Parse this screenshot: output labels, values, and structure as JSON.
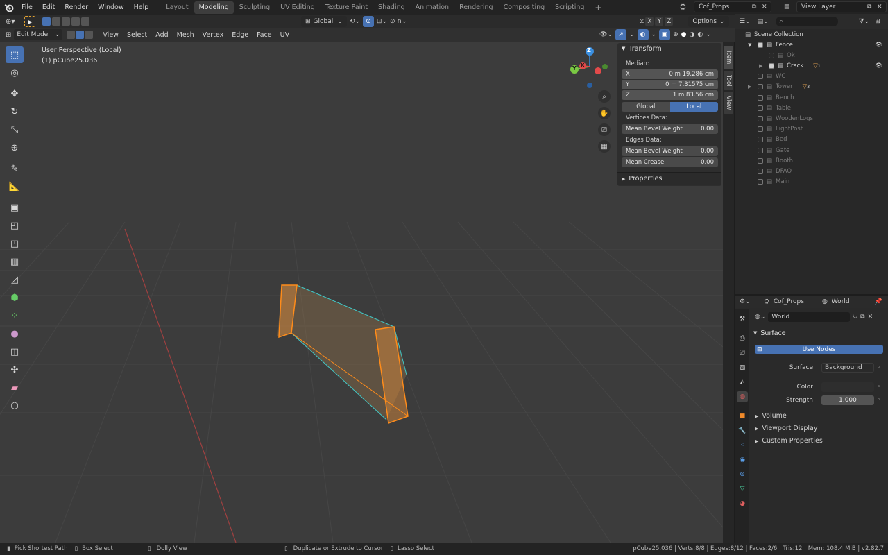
{
  "topbar": {
    "menus": [
      "File",
      "Edit",
      "Render",
      "Window",
      "Help"
    ],
    "workspaces": [
      "Layout",
      "Modeling",
      "Sculpting",
      "UV Editing",
      "Texture Paint",
      "Shading",
      "Animation",
      "Rendering",
      "Compositing",
      "Scripting"
    ],
    "active_workspace": "Modeling",
    "add_tab": "+",
    "scene": "Cof_Props",
    "view_layer": "View Layer"
  },
  "viewport_header": {
    "mode": "Edit Mode",
    "menus": [
      "View",
      "Select",
      "Add",
      "Mesh",
      "Vertex",
      "Edge",
      "Face",
      "UV"
    ],
    "transform_orientation": "Global",
    "axes": [
      "X",
      "Y",
      "Z"
    ],
    "options": "Options"
  },
  "viewport": {
    "perspective": "User Perspective (Local)",
    "object": "(1) pCube25.036",
    "gizmo": {
      "z": "Z",
      "y": "Y",
      "x": "X"
    }
  },
  "npanel": {
    "transform_title": "Transform",
    "median": "Median:",
    "x_label": "X",
    "x_value": "0 m 19.286 cm",
    "y_label": "Y",
    "y_value": "0 m 7.31575 cm",
    "z_label": "Z",
    "z_value": "1 m 83.56 cm",
    "global": "Global",
    "local": "Local",
    "vertices_data": "Vertices Data:",
    "mean_bevel_weight": "Mean Bevel Weight",
    "vertex_bevel_value": "0.00",
    "edges_data": "Edges Data:",
    "edge_bevel_value": "0.00",
    "mean_crease": "Mean Crease",
    "crease_value": "0.00",
    "properties_title": "Properties",
    "tabs": [
      "Item",
      "Tool",
      "View"
    ]
  },
  "outliner": {
    "root": "Scene Collection",
    "items": [
      {
        "name": "Fence",
        "checked": true,
        "indent": 1,
        "expanded": true,
        "eye": true
      },
      {
        "name": "Ok",
        "checked": false,
        "indent": 2,
        "dim": true
      },
      {
        "name": "Crack",
        "checked": true,
        "indent": 2,
        "expanded": false,
        "eye": true,
        "badge": "1"
      },
      {
        "name": "WC",
        "checked": false,
        "indent": 1,
        "dim": true
      },
      {
        "name": "Tower",
        "checked": false,
        "indent": 1,
        "dim": true,
        "badge": "3"
      },
      {
        "name": "Bench",
        "checked": false,
        "indent": 1,
        "dim": true
      },
      {
        "name": "Table",
        "checked": false,
        "indent": 1,
        "dim": true
      },
      {
        "name": "WoodenLogs",
        "checked": false,
        "indent": 1,
        "dim": true
      },
      {
        "name": "LightPost",
        "checked": false,
        "indent": 1,
        "dim": true
      },
      {
        "name": "Bed",
        "checked": false,
        "indent": 1,
        "dim": true
      },
      {
        "name": "Gate",
        "checked": false,
        "indent": 1,
        "dim": true
      },
      {
        "name": "Booth",
        "checked": false,
        "indent": 1,
        "dim": true
      },
      {
        "name": "DFAO",
        "checked": false,
        "indent": 1,
        "dim": true
      },
      {
        "name": "Main",
        "checked": false,
        "indent": 1,
        "dim": true
      }
    ]
  },
  "properties": {
    "scene": "Cof_Props",
    "world": "World",
    "world_field": "World",
    "surface_title": "Surface",
    "use_nodes": "Use Nodes",
    "surface_label": "Surface",
    "surface_value": "Background",
    "color_label": "Color",
    "strength_label": "Strength",
    "strength_value": "1.000",
    "volume": "Volume",
    "viewport_display": "Viewport Display",
    "custom_properties": "Custom Properties"
  },
  "statusbar": {
    "pick": "Pick Shortest Path",
    "box": "Box Select",
    "dolly": "Dolly View",
    "extrude": "Duplicate or Extrude to Cursor",
    "lasso": "Lasso Select",
    "stats": "pCube25.036 | Verts:8/8 | Edges:8/12 | Faces:2/6 | Tris:12 | Mem: 108.4 MiB | v2.82.7"
  },
  "colors": {
    "accent": "#4772b3",
    "selection": "#ff8c1a",
    "x_axis": "#e24a4a",
    "y_axis": "#7ac943",
    "z_axis": "#3a8fe0"
  }
}
